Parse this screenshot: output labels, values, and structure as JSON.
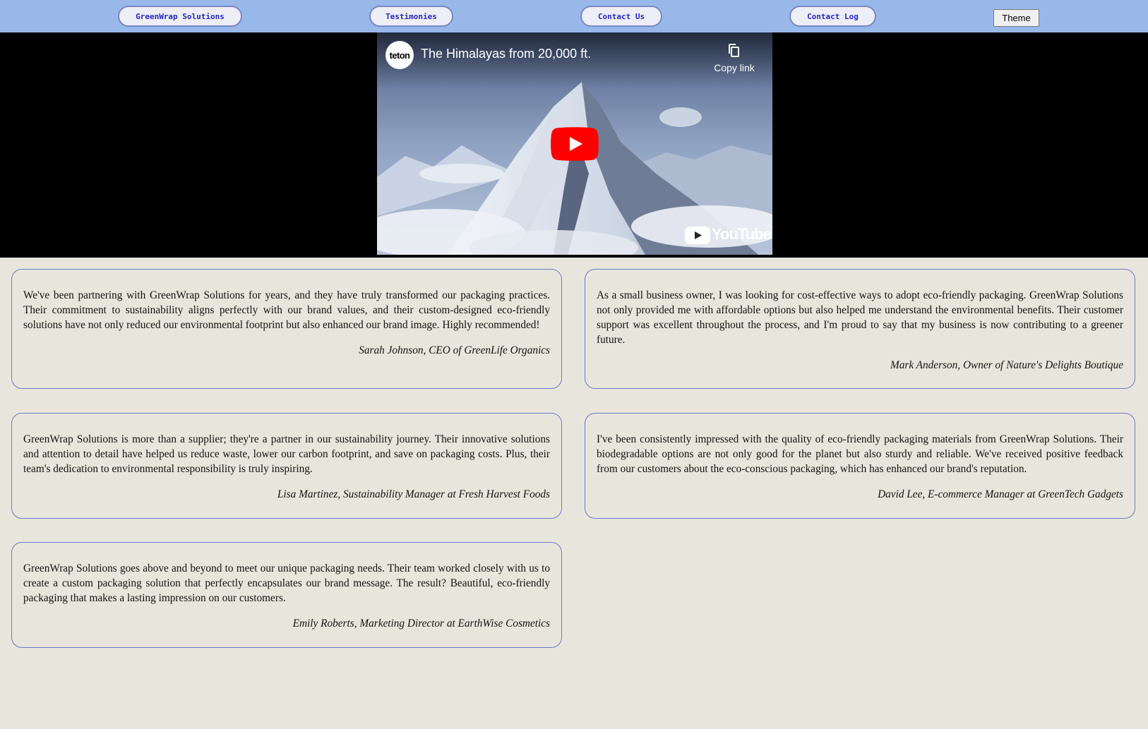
{
  "nav": {
    "links": [
      {
        "label": "GreenWrap Solutions"
      },
      {
        "label": "Testimonies"
      },
      {
        "label": "Contact Us"
      },
      {
        "label": "Contact Log"
      }
    ],
    "theme_label": "Theme"
  },
  "video": {
    "channel": "teton",
    "title": "The Himalayas from 20,000 ft.",
    "copy_link_label": "Copy link",
    "brand_label": "YouTube",
    "icons": [
      "copy-icon",
      "play-icon",
      "youtube-logo-icon"
    ],
    "play_color": "#ff0000"
  },
  "testimonials": [
    {
      "quote": "We've been partnering with GreenWrap Solutions for years, and they have truly transformed our packaging practices. Their commitment to sustainability aligns perfectly with our brand values, and their custom-designed eco-friendly solutions have not only reduced our environmental footprint but also enhanced our brand image. Highly recommended!",
      "author": "Sarah Johnson, CEO of GreenLife Organics"
    },
    {
      "quote": "As a small business owner, I was looking for cost-effective ways to adopt eco-friendly packaging. GreenWrap Solutions not only provided me with affordable options but also helped me understand the environmental benefits. Their customer support was excellent throughout the process, and I'm proud to say that my business is now contributing to a greener future.",
      "author": "Mark Anderson, Owner of Nature's Delights Boutique"
    },
    {
      "quote": "GreenWrap Solutions is more than a supplier; they're a partner in our sustainability journey. Their innovative solutions and attention to detail have helped us reduce waste, lower our carbon footprint, and save on packaging costs. Plus, their team's dedication to environmental responsibility is truly inspiring.",
      "author": "Lisa Martinez, Sustainability Manager at Fresh Harvest Foods"
    },
    {
      "quote": "I've been consistently impressed with the quality of eco-friendly packaging materials from GreenWrap Solutions. Their biodegradable options are not only good for the planet but also sturdy and reliable. We've received positive feedback from our customers about the eco-conscious packaging, which has enhanced our brand's reputation.",
      "author": "David Lee, E-commerce Manager at GreenTech Gadgets"
    },
    {
      "quote": "GreenWrap Solutions goes above and beyond to meet our unique packaging needs. Their team worked closely with us to create a custom packaging solution that perfectly encapsulates our brand message. The result? Beautiful, eco-friendly packaging that makes a lasting impression on our customers.",
      "author": "Emily Roberts, Marketing Director at EarthWise Cosmetics"
    }
  ],
  "colors": {
    "nav_background": "#98b8ea",
    "nav_button_text": "#2626c8",
    "nav_button_border": "#7a86c6",
    "page_background": "#e8e6dc",
    "card_border": "#6a79c9",
    "video_background": "#000000"
  }
}
